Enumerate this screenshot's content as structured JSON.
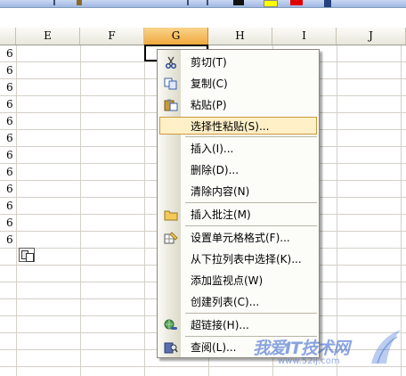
{
  "columns": [
    {
      "id": "E",
      "label": "E"
    },
    {
      "id": "F",
      "label": "F"
    },
    {
      "id": "G",
      "label": "G",
      "active": true
    },
    {
      "id": "H",
      "label": "H"
    },
    {
      "id": "I",
      "label": "I"
    },
    {
      "id": "J",
      "label": "J"
    }
  ],
  "row_values": [
    "6",
    "6",
    "6",
    "6",
    "6",
    "6",
    "6",
    "6",
    "6",
    "6",
    "6",
    "6"
  ],
  "colors": {
    "menu_highlight_bg": "#fff0c8",
    "menu_highlight_border": "#c99a3e",
    "active_column_header": "#f1a83e"
  },
  "context_menu": {
    "items": [
      {
        "label": "剪切(T)",
        "icon": "scissors-icon"
      },
      {
        "label": "复制(C)",
        "icon": "copy-icon"
      },
      {
        "label": "粘贴(P)",
        "icon": "paste-icon"
      },
      {
        "label": "选择性粘贴(S)...",
        "highlighted": true
      },
      {
        "label": "插入(I)..."
      },
      {
        "label": "删除(D)..."
      },
      {
        "label": "清除内容(N)"
      },
      {
        "label": "插入批注(M)",
        "icon": "folder-comment-icon"
      },
      {
        "label": "设置单元格格式(F)...",
        "icon": "format-cells-icon"
      },
      {
        "label": "从下拉列表中选择(K)..."
      },
      {
        "label": "添加监视点(W)"
      },
      {
        "label": "创建列表(C)..."
      },
      {
        "label": "超链接(H)...",
        "icon": "globe-link-icon"
      },
      {
        "label": "查阅(L)...",
        "icon": "research-book-icon"
      }
    ]
  },
  "watermark": {
    "text": "我爱IT技术网",
    "url": "www.52ij.com"
  }
}
